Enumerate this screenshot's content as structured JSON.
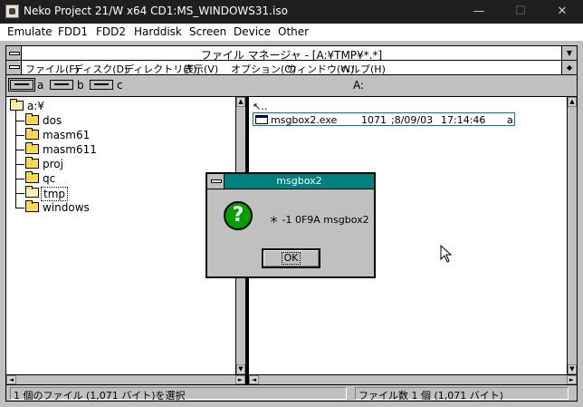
{
  "host": {
    "title": "Neko Project 21/W x64  CD1:MS_WINDOWS31.iso",
    "controls": {
      "minimize": "—",
      "maximize": "☐",
      "close": "✕"
    },
    "menu": [
      "Emulate",
      "FDD1",
      "FDD2",
      "Harddisk",
      "Screen",
      "Device",
      "Other"
    ]
  },
  "file_manager": {
    "title": "ファイル マネージャ - [A:¥TMP¥*.*]",
    "menu": [
      "ファイル(F)",
      "ディスク(D)",
      "ディレクトリ(T)",
      "表示(V)",
      "オプション(O)",
      "ウィンドウ(W)",
      "ヘルプ(H)"
    ],
    "drives": [
      "a",
      "b",
      "c"
    ],
    "current_drive_label": "A:",
    "tree": {
      "root": "a:¥",
      "folders": [
        "dos",
        "masm61",
        "masm611",
        "proj",
        "qc",
        "tmp",
        "windows"
      ],
      "selected": "tmp"
    },
    "files": {
      "up_entry": "..",
      "rows": [
        {
          "name": "msgbox2.exe",
          "size": "1071",
          "date": ";8/09/03",
          "time": "17:14:46",
          "attr": "a"
        }
      ]
    },
    "status": {
      "left": "1 個のファイル (1,071 バイト)を選択",
      "right": "ファイル数 1 個 (1,071 バイト)"
    }
  },
  "dialog": {
    "title": "msgbox2",
    "icon": "question-icon",
    "icon_glyph": "?",
    "message": "＊ -1 0F9A msgbox2",
    "ok_label": "OK",
    "title_color": "#008080"
  }
}
